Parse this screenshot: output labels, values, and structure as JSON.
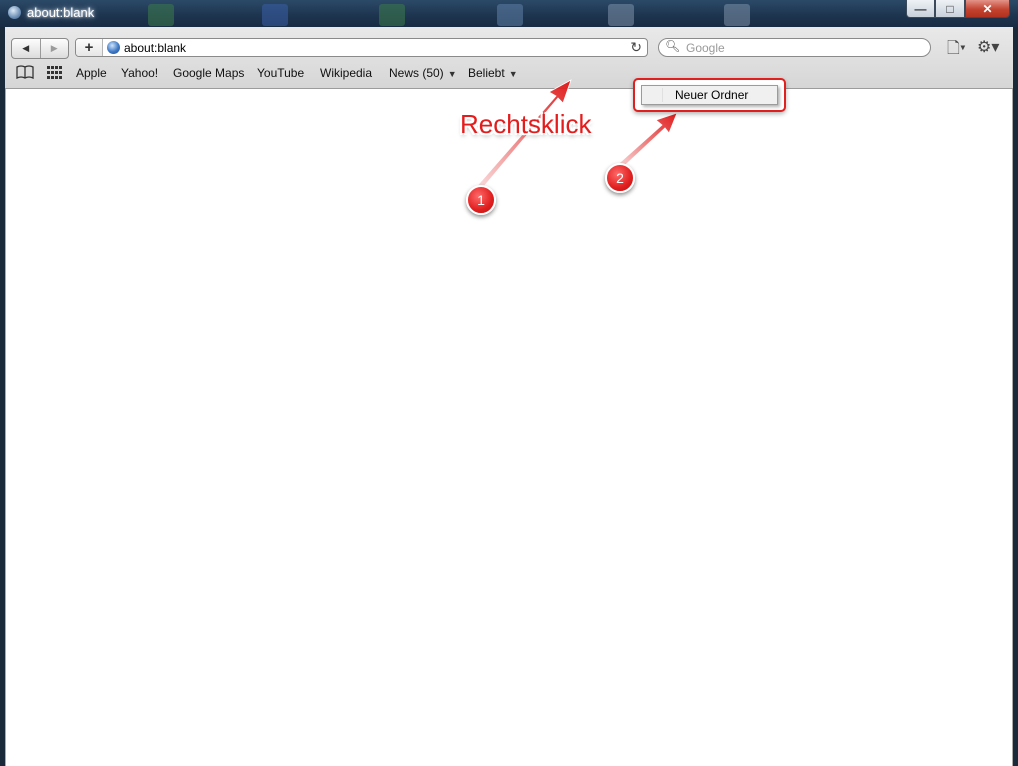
{
  "window": {
    "title": "about:blank",
    "minimize_glyph": "—",
    "maximize_glyph": "□",
    "close_glyph": "✕"
  },
  "toolbar": {
    "back_glyph": "◀",
    "forward_glyph": "▶",
    "add_glyph": "+",
    "url": "about:blank",
    "reload_glyph": "↻",
    "search_placeholder": "Google",
    "search_icon": "magnifier-icon",
    "page_menu_glyph": "🗋▾",
    "settings_glyph": "⚙▾"
  },
  "bookmarks": {
    "reading_list_icon": "open-book-icon",
    "top_sites_icon": "grid-icon",
    "items": [
      {
        "label": "Apple"
      },
      {
        "label": "Yahoo!"
      },
      {
        "label": "Google Maps"
      },
      {
        "label": "YouTube"
      },
      {
        "label": "Wikipedia"
      },
      {
        "label": "News (50)",
        "has_menu": true
      },
      {
        "label": "Beliebt",
        "has_menu": true
      }
    ]
  },
  "context_menu": {
    "items": [
      {
        "label": "Neuer Ordner"
      }
    ]
  },
  "annotations": {
    "callout_text": "Rechtsklick",
    "step1": "1",
    "step2": "2",
    "accent_color": "#e01f1f"
  }
}
